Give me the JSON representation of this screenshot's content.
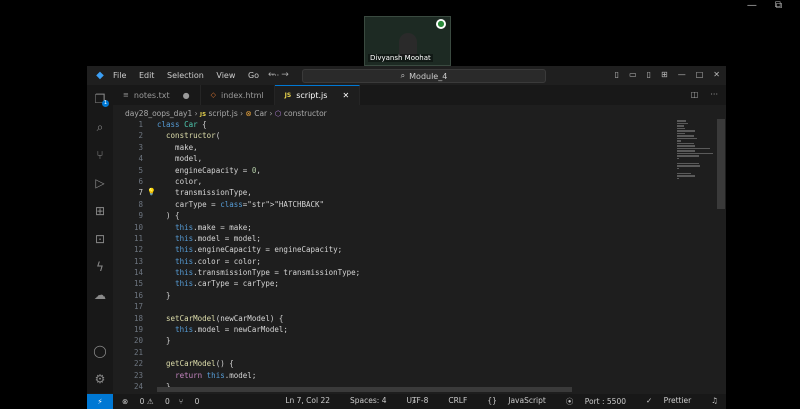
{
  "meeting": {
    "participant_name": "Divyansh Moohat"
  },
  "window": {
    "title": "Module_4"
  },
  "menu": [
    "File",
    "Edit",
    "Selection",
    "View",
    "Go",
    "···"
  ],
  "tabs": [
    {
      "label": "notes.txt",
      "modified": true
    },
    {
      "label": "index.html",
      "modified": false
    },
    {
      "label": "script.js",
      "modified": false,
      "active": true
    }
  ],
  "breadcrumb": {
    "folder": "day28_oops_day1",
    "file": "script.js",
    "symbol1": "Car",
    "symbol2": "constructor"
  },
  "editor": {
    "current_line": 7,
    "lines": [
      "class Car {",
      "  constructor(",
      "    make,",
      "    model,",
      "    engineCapacity = 0,",
      "    color,",
      "    transmissionType,",
      "    carType = \"HATCHBACK\"",
      "  ) {",
      "    this.make = make;",
      "    this.model = model;",
      "    this.engineCapacity = engineCapacity;",
      "    this.color = color;",
      "    this.transmissionType = transmissionType;",
      "    this.carType = carType;",
      "  }",
      "",
      "  setCarModel(newCarModel) {",
      "    this.model = newCarModel;",
      "  }",
      "",
      "  getCarModel() {",
      "    return this.model;",
      "  }"
    ]
  },
  "status": {
    "errors": "0",
    "warnings": "0",
    "ports": "0",
    "position": "Ln 7, Col 22",
    "spaces": "Spaces: 4",
    "encoding": "UTF-8",
    "eol": "CRLF",
    "language": "JavaScript",
    "port": "Port : 5500",
    "formatter": "Prettier"
  },
  "colors": {
    "accent": "#0078d4",
    "background": "#1e1e1e",
    "keyword": "#569cd6",
    "class": "#4ec9b0",
    "string": "#ce9178"
  }
}
